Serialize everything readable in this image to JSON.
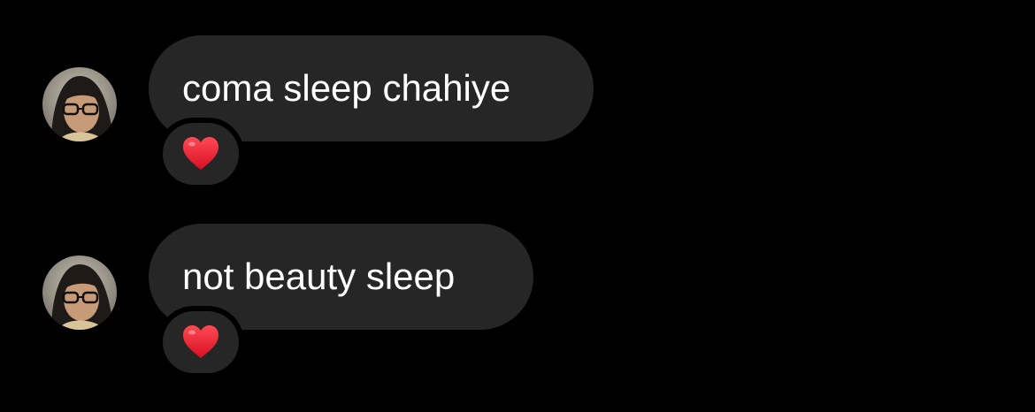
{
  "messages": [
    {
      "text": "coma sleep chahiye",
      "reaction": "heart-icon",
      "reaction_color": "#e8192c"
    },
    {
      "text": "not beauty sleep",
      "reaction": "heart-icon",
      "reaction_color": "#e8192c"
    }
  ],
  "colors": {
    "background": "#000000",
    "bubble": "#262626",
    "text": "#ffffff"
  }
}
